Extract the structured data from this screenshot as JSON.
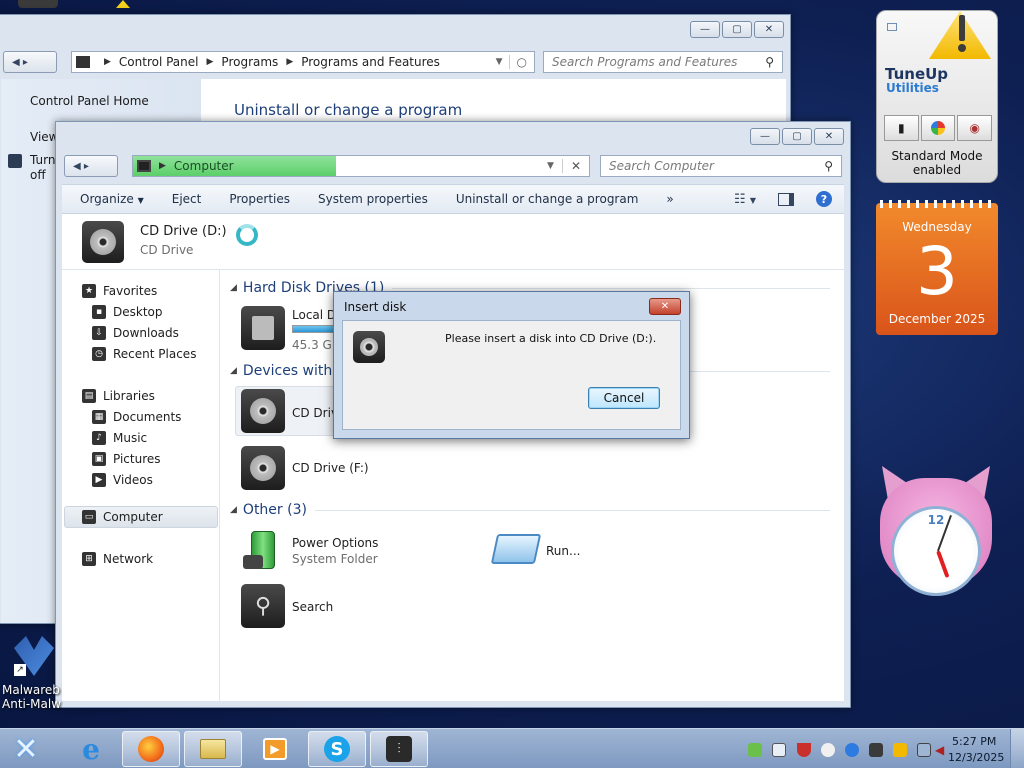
{
  "back_window": {
    "breadcrumb": [
      "Control Panel",
      "Programs",
      "Programs and Features"
    ],
    "search_placeholder": "Search Programs and Features",
    "sidebar_home": "Control Panel Home",
    "sidebar_view": "View",
    "sidebar_turn": "Turn",
    "sidebar_off": "off",
    "heading": "Uninstall or change a program"
  },
  "explorer": {
    "address": "Computer",
    "search_placeholder": "Search Computer",
    "toolbar": {
      "organize": "Organize",
      "eject": "Eject",
      "properties": "Properties",
      "system_properties": "System properties",
      "uninstall": "Uninstall or change a program",
      "more": "»"
    },
    "details": {
      "name": "CD Drive (D:)",
      "type": "CD Drive"
    },
    "nav": {
      "favorites": "Favorites",
      "desktop": "Desktop",
      "downloads": "Downloads",
      "recent": "Recent Places",
      "libraries": "Libraries",
      "documents": "Documents",
      "music": "Music",
      "pictures": "Pictures",
      "videos": "Videos",
      "computer": "Computer",
      "network": "Network"
    },
    "groups": {
      "hdd": "Hard Disk Drives (1)",
      "devices": "Devices with Removable Storage",
      "other": "Other (3)"
    },
    "items": {
      "local_disk": "Local Disk (C:)",
      "local_disk_size": "45.3 GB",
      "local_disk_fill": 0.45,
      "cd_d": "CD Drive (D:)",
      "cd_f": "CD Drive (F:)",
      "power_options": "Power Options",
      "power_options_sub": "System Folder",
      "run": "Run...",
      "search": "Search"
    }
  },
  "dialog": {
    "title": "Insert disk",
    "message": "Please insert a disk into CD Drive (D:).",
    "cancel": "Cancel"
  },
  "gadgets": {
    "tuneup_line1": "TuneUp",
    "tuneup_line2": "Utilities",
    "tuneup_mode1": "Standard Mode",
    "tuneup_mode2": "enabled",
    "cal_weekday": "Wednesday",
    "cal_day": "3",
    "cal_month": "December 2025",
    "clock_12": "12"
  },
  "desktop": {
    "malware_line1": "Malwareb",
    "malware_line2": "Anti-Malw"
  },
  "taskbar": {
    "time": "5:27 PM",
    "date": "12/3/2025"
  },
  "colors": {
    "accent_blue": "#1e3f7a",
    "progress_green": "#5ccf6a",
    "calendar_orange": "#e8701f"
  }
}
